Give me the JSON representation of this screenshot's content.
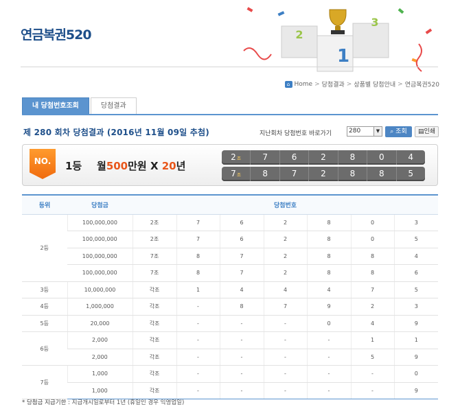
{
  "header": {
    "logo": "연금복권520"
  },
  "breadcrumb": {
    "home": "Home",
    "items": [
      "당첨결과",
      "상품별 당첨안내",
      "연금복권520"
    ]
  },
  "tabs": [
    {
      "label": "내 당첨번호조회"
    },
    {
      "label": "당첨결과"
    }
  ],
  "title": "제 280 회차 당첨결과 (2016년 11월 09일 추첨)",
  "search": {
    "label": "지난회차 당첨번호 바로가기",
    "selected": "280",
    "query_button": "조회",
    "print_button": "인쇄"
  },
  "winner": {
    "badge": "NO.",
    "rank": "1등",
    "prize_prefix": "월",
    "prize_amount": "500",
    "prize_unit": "만원",
    "times": " X ",
    "years": "20",
    "years_unit": "년",
    "rows": [
      {
        "group": "2",
        "group_unit": "조",
        "digits": [
          "7",
          "6",
          "2",
          "8",
          "0",
          "4"
        ]
      },
      {
        "group": "7",
        "group_unit": "조",
        "digits": [
          "8",
          "7",
          "2",
          "8",
          "8",
          "5"
        ]
      }
    ]
  },
  "table": {
    "headers": [
      "등위",
      "당첨금",
      "당첨번호"
    ],
    "groups": [
      {
        "rank": "2등",
        "rows": [
          {
            "amount": "100,000,000",
            "group": "2조",
            "digits": [
              "7",
              "6",
              "2",
              "8",
              "0",
              "3"
            ]
          },
          {
            "amount": "100,000,000",
            "group": "2조",
            "digits": [
              "7",
              "6",
              "2",
              "8",
              "0",
              "5"
            ]
          },
          {
            "amount": "100,000,000",
            "group": "7조",
            "digits": [
              "8",
              "7",
              "2",
              "8",
              "8",
              "4"
            ]
          },
          {
            "amount": "100,000,000",
            "group": "7조",
            "digits": [
              "8",
              "7",
              "2",
              "8",
              "8",
              "6"
            ]
          }
        ]
      },
      {
        "rank": "3등",
        "rows": [
          {
            "amount": "10,000,000",
            "group": "각조",
            "digits": [
              "1",
              "4",
              "4",
              "4",
              "7",
              "5"
            ]
          }
        ]
      },
      {
        "rank": "4등",
        "rows": [
          {
            "amount": "1,000,000",
            "group": "각조",
            "digits": [
              "-",
              "8",
              "7",
              "9",
              "2",
              "3"
            ]
          }
        ]
      },
      {
        "rank": "5등",
        "rows": [
          {
            "amount": "20,000",
            "group": "각조",
            "digits": [
              "-",
              "-",
              "-",
              "0",
              "4",
              "9"
            ]
          }
        ]
      },
      {
        "rank": "6등",
        "rows": [
          {
            "amount": "2,000",
            "group": "각조",
            "digits": [
              "-",
              "-",
              "-",
              "-",
              "1",
              "1"
            ]
          },
          {
            "amount": "2,000",
            "group": "각조",
            "digits": [
              "-",
              "-",
              "-",
              "-",
              "5",
              "9"
            ]
          }
        ]
      },
      {
        "rank": "7등",
        "rows": [
          {
            "amount": "1,000",
            "group": "각조",
            "digits": [
              "-",
              "-",
              "-",
              "-",
              "-",
              "0"
            ]
          },
          {
            "amount": "1,000",
            "group": "각조",
            "digits": [
              "-",
              "-",
              "-",
              "-",
              "-",
              "9"
            ]
          }
        ]
      }
    ]
  },
  "note": {
    "label": "* 당첨금 지급기한 :",
    "text": "지급개시일로부터 1년 (휴일인 경우 익영업일)"
  },
  "colors": {
    "accent": "#5b94cf",
    "title": "#1e4f8a",
    "prize_highlight": "#e8561a",
    "ball_bg": "#6c6c6c"
  }
}
